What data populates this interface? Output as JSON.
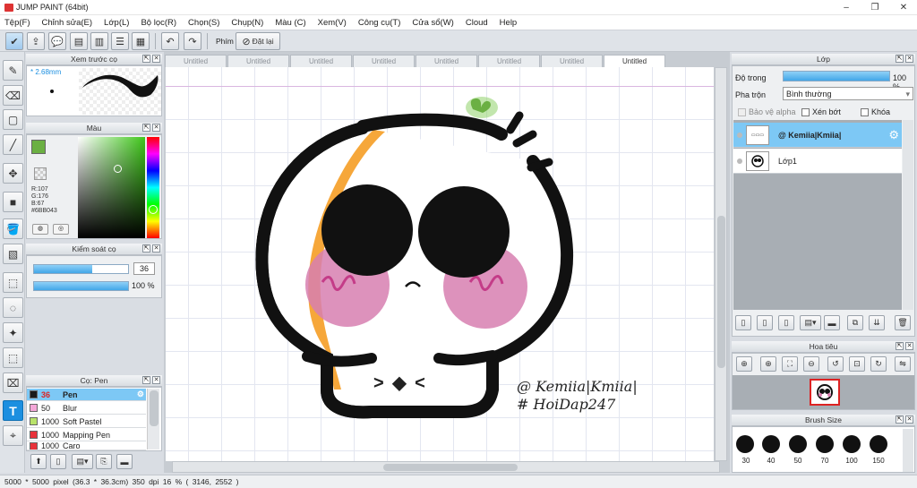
{
  "app": {
    "title": "JUMP PAINT (64bit)"
  },
  "window_buttons": [
    "–",
    "❐",
    "✕"
  ],
  "menu": [
    "Tệp(F)",
    "Chỉnh sửa(E)",
    "Lớp(L)",
    "Bộ lọc(R)",
    "Chọn(S)",
    "Chụp(N)",
    "Màu (C)",
    "Xem(V)",
    "Công cụ(T)",
    "Cửa sổ(W)",
    "Cloud",
    "Help"
  ],
  "toolbar": {
    "phim_label": "Phím",
    "reset_label": "Đặt lại"
  },
  "brush_preview": {
    "title": "Xem trước cọ",
    "size": "* 2.68mm"
  },
  "color_panel": {
    "title": "Màu",
    "r": "R:107",
    "g": "G:176",
    "b": "B:67",
    "hex": "#6BB043",
    "current": "#6bb043"
  },
  "brush_control": {
    "title": "Kiểm soát cọ",
    "size_value": "36",
    "opacity_value": "100 %"
  },
  "brush_list": {
    "title": "Cọ: Pen",
    "items": [
      {
        "size": "36",
        "name": "Pen",
        "color": "#1a1a1a"
      },
      {
        "size": "50",
        "name": "Blur",
        "color": "#f4a7d8"
      },
      {
        "size": "1000",
        "name": "Soft Pastel",
        "color": "#b8e26a"
      },
      {
        "size": "1000",
        "name": "Mapping Pen",
        "color": "#e8323a"
      },
      {
        "size": "1000",
        "name": "Caro",
        "color": "#e8323a"
      }
    ]
  },
  "doc_tabs": [
    "Untitled",
    "Untitled",
    "Untitled",
    "Untitled",
    "Untitled",
    "Untitled",
    "Untitled",
    "Untitled"
  ],
  "canvas_text": {
    "line1": "@ Kemiia|Kmiia|",
    "line2": "# HoiDap247",
    "face_mouth": "> ◆ <"
  },
  "layer_panel": {
    "title": "Lớp",
    "opacity_label": "Độ trong",
    "opacity_value": "100 %",
    "opacity_fraction": 1.0,
    "blend_label": "Pha trộn",
    "blend_value": "Bình thường",
    "protect_alpha": "Bảo vệ alpha",
    "clip": "Xén bớt",
    "lock": "Khóa",
    "layers": [
      {
        "name": "@ Kemiia|Kmiia|"
      },
      {
        "name": "Lớp1"
      }
    ]
  },
  "navigator": {
    "title": "Hoa tiêu"
  },
  "brush_size": {
    "title": "Brush Size",
    "sizes": [
      "30",
      "40",
      "50",
      "70",
      "100",
      "150"
    ]
  },
  "status": {
    "text": "5000 * 5000 pixel   (36.3 * 36.3cm)   350 dpi   16 %   ( 3146, 2552 )"
  }
}
